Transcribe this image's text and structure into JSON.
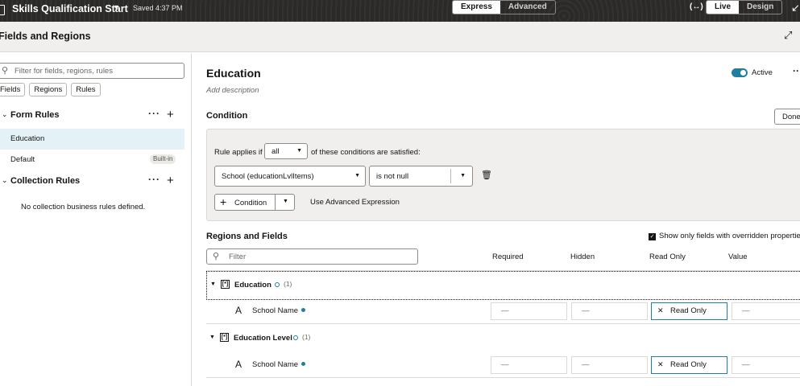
{
  "topbar": {
    "title": "Skills Qualification Start",
    "saved": "Saved 4:37 PM",
    "mode_tabs": [
      "Express",
      "Advanced"
    ],
    "view_tabs": [
      "Live",
      "Design"
    ],
    "active_mode": "Express",
    "active_view": "Live",
    "code_icon": "(↔)"
  },
  "panel": {
    "title": "Fields and Regions"
  },
  "sidebar": {
    "search_placeholder": "Filter for fields, regions, rules",
    "chips": [
      "Fields",
      "Regions",
      "Rules"
    ],
    "form_rules_title": "Form Rules",
    "form_rules": [
      {
        "label": "Education",
        "selected": true
      },
      {
        "label": "Default",
        "badge": "Built-in"
      }
    ],
    "collection_rules_title": "Collection Rules",
    "collection_empty": "No collection business rules defined."
  },
  "rule": {
    "title": "Education",
    "description_placeholder": "Add description",
    "active_label": "Active",
    "active": true
  },
  "condition": {
    "title": "Condition",
    "done_label": "Done",
    "applies_prefix": "Rule applies if",
    "applies_value": "all",
    "applies_suffix": "of these conditions are satisfied:",
    "field_value": "School (educationLvlItems)",
    "operator_value": "is not null",
    "add_condition_label": "Condition",
    "advanced_link": "Use Advanced Expression"
  },
  "regions_fields": {
    "title": "Regions and Fields",
    "override_label": "Show only fields with overridden properties",
    "override_checked": true,
    "filter_placeholder": "Filter",
    "columns": [
      "Required",
      "Hidden",
      "Read Only",
      "Value"
    ],
    "regions": [
      {
        "label": "Education",
        "count": "(1)",
        "fields": [
          {
            "label": "School Name",
            "required": "—",
            "hidden": "—",
            "read_only": "Read Only",
            "value": "—"
          }
        ]
      },
      {
        "label": "Education Level",
        "count": "(1)",
        "fields": [
          {
            "label": "School Name",
            "required": "—",
            "hidden": "—",
            "read_only": "Read Only",
            "value": "—"
          }
        ]
      }
    ]
  },
  "colors": {
    "accent": "#227e9e",
    "topbar": "#2b2a28",
    "selected_row": "#e4f1f6",
    "panel_bg": "#f1efed"
  }
}
